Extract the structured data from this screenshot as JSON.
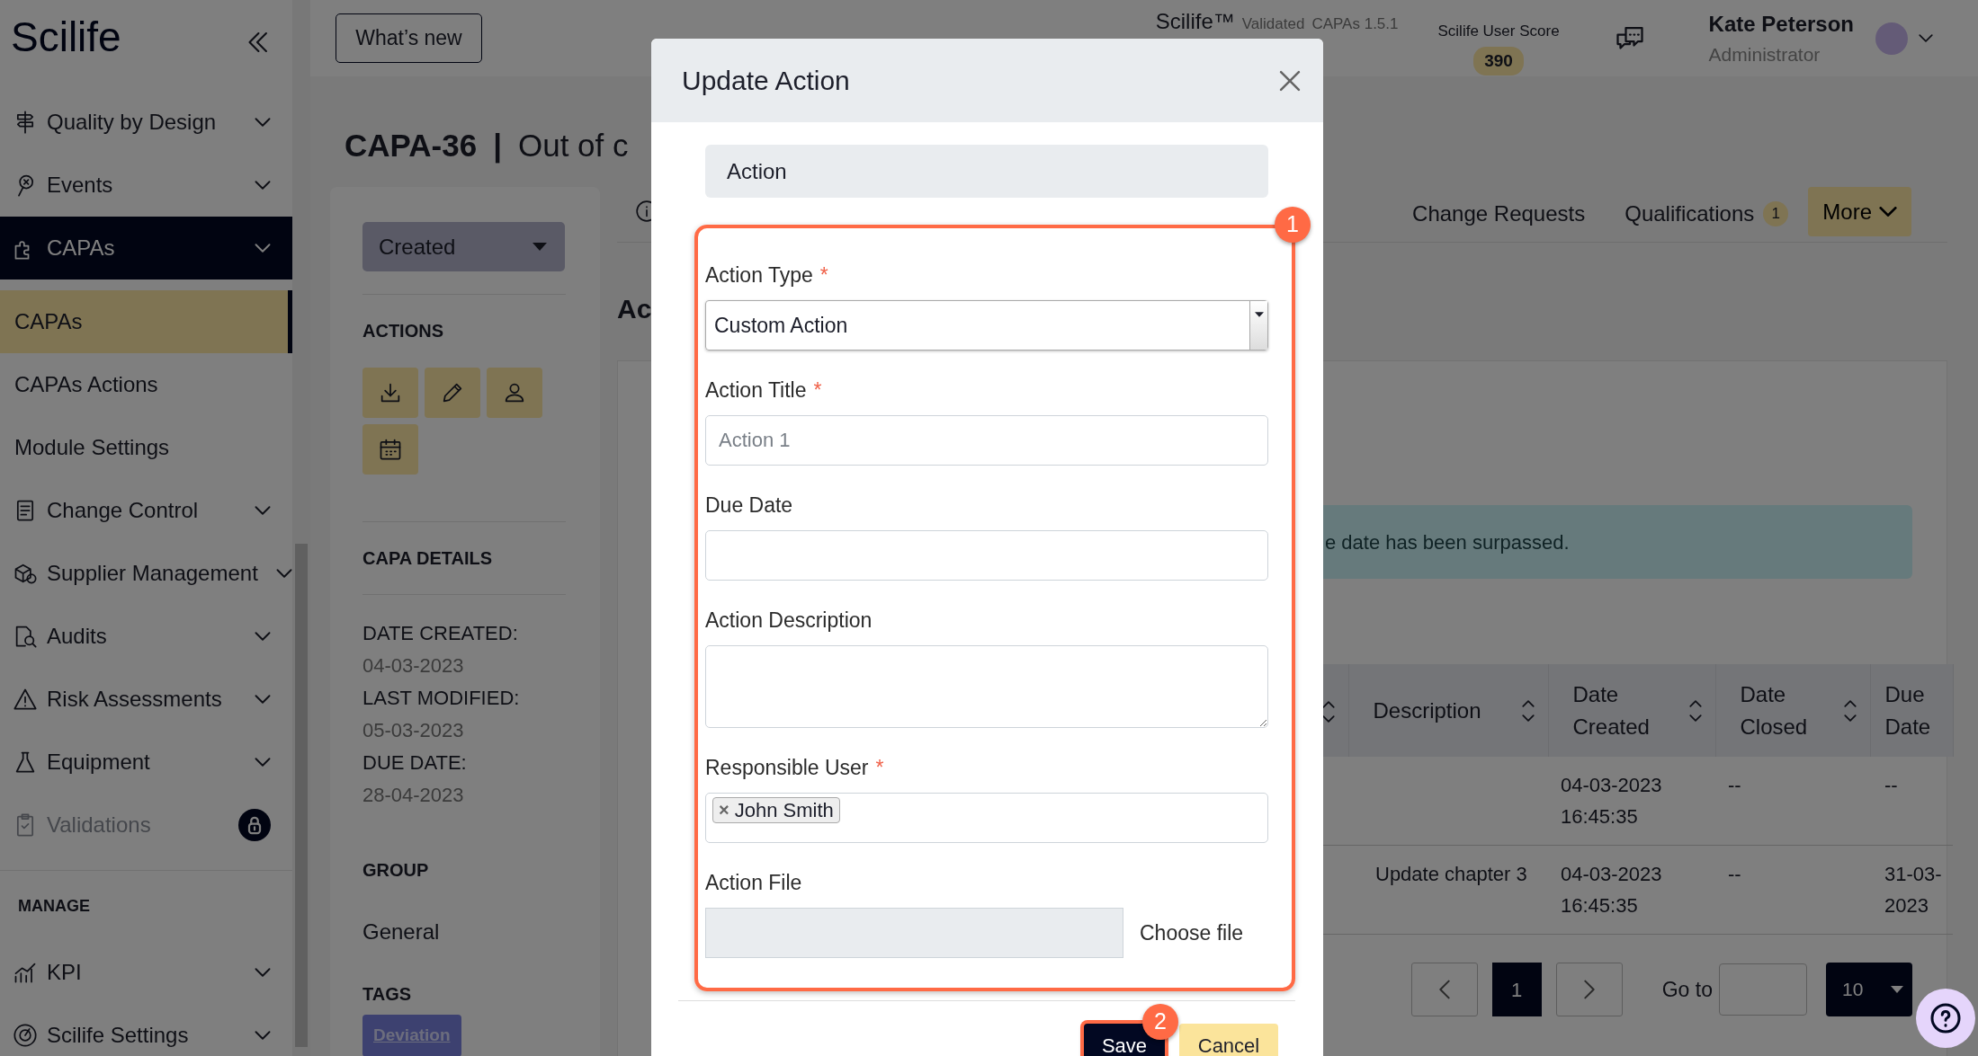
{
  "sidebar": {
    "logo": "Scilife",
    "modules": [
      {
        "label": "Quality by Design",
        "selected": false,
        "locked": false
      },
      {
        "label": "Events",
        "selected": false,
        "locked": false
      },
      {
        "label": "CAPAs",
        "selected": true,
        "locked": false,
        "children": [
          {
            "label": "CAPAs",
            "selected": true
          },
          {
            "label": "CAPAs Actions",
            "selected": false
          },
          {
            "label": "Module Settings",
            "selected": false
          }
        ]
      },
      {
        "label": "Change Control",
        "selected": false,
        "locked": false
      },
      {
        "label": "Supplier Management",
        "selected": false,
        "locked": false
      },
      {
        "label": "Audits",
        "selected": false,
        "locked": false
      },
      {
        "label": "Risk Assessments",
        "selected": false,
        "locked": false
      },
      {
        "label": "Equipment",
        "selected": false,
        "locked": false
      },
      {
        "label": "Validations",
        "selected": false,
        "locked": true
      }
    ],
    "section_title": "MANAGE",
    "manage": [
      {
        "label": "KPI",
        "selected": false
      },
      {
        "label": "Scilife Settings",
        "selected": false
      }
    ]
  },
  "topbar": {
    "whats_new": "What’s new",
    "product": "Scilife™",
    "validated": "Validated",
    "version": "CAPAs 1.5.1",
    "score_label": "Scilife User Score",
    "score": "390",
    "user_name": "Kate Peterson",
    "user_role": "Administrator"
  },
  "record": {
    "id": "CAPA-36",
    "separator": "|",
    "title": "Out of c",
    "status": "Created",
    "actions_title": "ACTIONS",
    "details_title": "CAPA DETAILS",
    "details": [
      {
        "label": "DATE CREATED:",
        "value": "04-03-2023"
      },
      {
        "label": "LAST MODIFIED:",
        "value": "05-03-2023"
      },
      {
        "label": "DUE DATE:",
        "value": "28-04-2023"
      }
    ],
    "group_title": "GROUP",
    "group": "General",
    "tags_title": "TAGS",
    "tags": [
      "Deviation"
    ]
  },
  "tabs": [
    {
      "label": "Change Requests",
      "selected": false
    },
    {
      "label": "Qualifications",
      "count": "1",
      "selected": false
    }
  ],
  "more": "More",
  "section_heading": "Ac",
  "alert": "e date has been surpassed.",
  "table": {
    "columns": [
      "Description",
      "Date Created",
      "Date Closed",
      "Due Date"
    ],
    "rows": [
      {
        "date_created": "04-03-2023 16:45:35",
        "date_closed": "--",
        "due_date": "--"
      },
      {
        "description": "Update chapter 3",
        "date_created": "04-03-2023 16:45:35",
        "date_closed": "--",
        "due_date": "31-03-2023"
      }
    ]
  },
  "pagination": {
    "pages": [
      {
        "label": "1",
        "selected": true
      }
    ],
    "goto_label": "Go to",
    "page_size": "10"
  },
  "modal": {
    "title": "Update Action",
    "section": "Action",
    "required_mark": "*",
    "fields_callout": "1",
    "fields": [
      {
        "kind": "select",
        "label": "Action Type",
        "required": true,
        "value": "Custom Action"
      },
      {
        "kind": "text",
        "label": "Action Title",
        "required": true,
        "placeholder": "Action 1"
      },
      {
        "kind": "date",
        "label": "Due Date",
        "required": false
      },
      {
        "kind": "textarea",
        "label": "Action Description",
        "required": false
      },
      {
        "kind": "tags",
        "label": "Responsible User",
        "required": true,
        "tags": [
          {
            "label": "John Smith",
            "remove": "×"
          }
        ]
      },
      {
        "kind": "file",
        "label": "Action File",
        "required": false,
        "button": "Choose file"
      }
    ],
    "buttons": [
      {
        "label": "Save",
        "kind": "primary",
        "callout": "2"
      },
      {
        "label": "Cancel",
        "kind": "secondary"
      }
    ]
  }
}
